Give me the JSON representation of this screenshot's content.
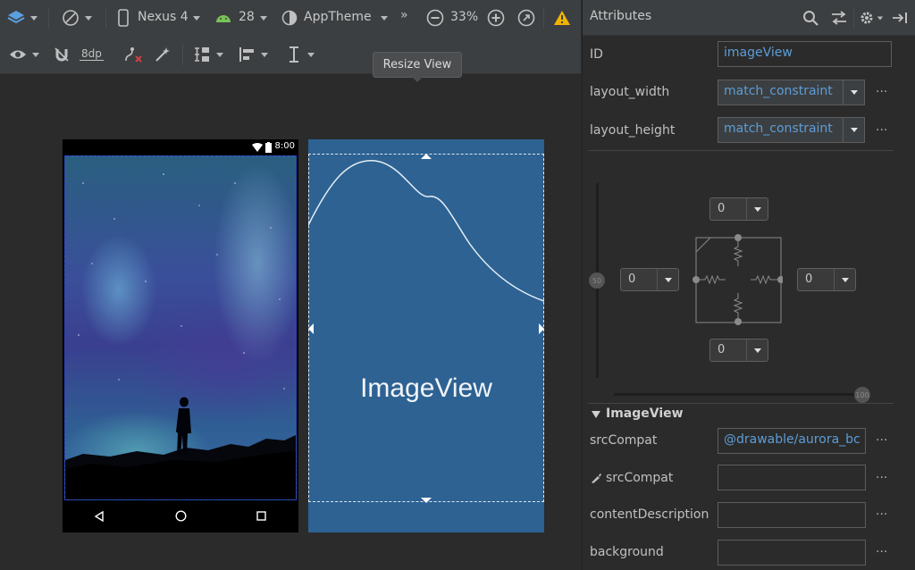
{
  "toolbar": {
    "device": "Nexus 4",
    "api_level": "28",
    "theme": "AppTheme",
    "zoom": "33%",
    "margin_default": "8dp"
  },
  "tooltip": "Resize View",
  "device_preview": {
    "status_time": "8:00"
  },
  "blueprint": {
    "label": "ImageView"
  },
  "panel": {
    "title": "Attributes",
    "id_label": "ID",
    "id_value": "imageView",
    "layout_width_label": "layout_width",
    "layout_width_value": "match_constraint",
    "layout_height_label": "layout_height",
    "layout_height_value": "match_constraint",
    "more_glyph": "···",
    "constraints": {
      "top": "0",
      "left": "0",
      "right": "0",
      "bottom": "0",
      "bias_vertical": "50",
      "bias_horizontal": "100"
    },
    "section_title": "ImageView",
    "src_compat_label": "srcCompat",
    "src_compat_value": "@drawable/aurora_bc",
    "tools_src_compat_label": "srcCompat",
    "tools_src_compat_value": "",
    "content_description_label": "contentDescription",
    "content_description_value": "",
    "background_label": "background",
    "background_value": ""
  },
  "colors": {
    "accent": "#5d9dd8",
    "blueprint": "#2d6293",
    "warning": "#f0b400"
  }
}
